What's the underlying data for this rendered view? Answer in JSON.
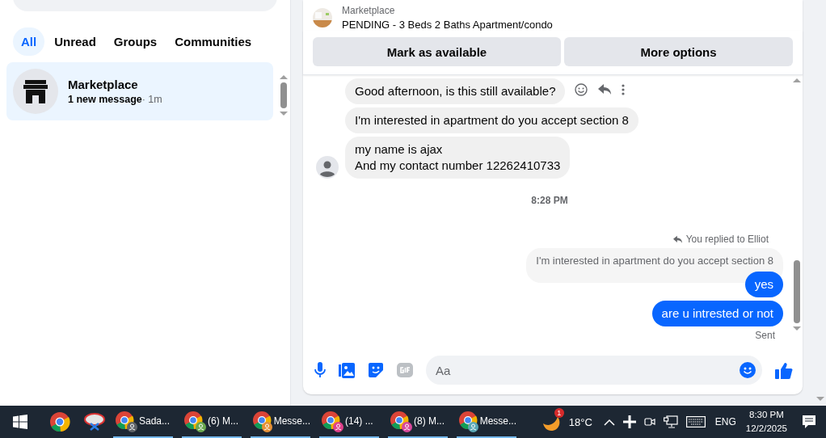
{
  "sidebar": {
    "filters": [
      {
        "label": "All",
        "selected": true
      },
      {
        "label": "Unread",
        "selected": false
      },
      {
        "label": "Groups",
        "selected": false
      },
      {
        "label": "Communities",
        "selected": false
      }
    ],
    "conversations": [
      {
        "name": "Marketplace",
        "preview": "1 new message",
        "time": "· 1m",
        "selected": true
      }
    ]
  },
  "chat": {
    "listing": {
      "label": "Marketplace",
      "title": "PENDING - 3 Beds 2 Baths Apartment/condo"
    },
    "actions": [
      "Mark as available",
      "More options"
    ],
    "messages": [
      {
        "kind": "incoming",
        "lines": [
          "Good afternoon, is this still available?"
        ],
        "show_actions": true,
        "show_avatar": false
      },
      {
        "kind": "incoming",
        "lines": [
          "I'm interested in apartment do you accept section 8"
        ],
        "show_actions": false,
        "show_avatar": false
      },
      {
        "kind": "incoming",
        "lines": [
          "my name is ajax",
          "And my contact number 12262410733"
        ],
        "show_actions": false,
        "show_avatar": true
      },
      {
        "kind": "timestamp",
        "text": "8:28 PM"
      },
      {
        "kind": "reply_note",
        "text": "You replied to Elliot"
      },
      {
        "kind": "quoted",
        "text": "I'm interested in apartment do you accept section 8"
      },
      {
        "kind": "outgoing",
        "text": "yes"
      },
      {
        "kind": "outgoing",
        "text": "are u intrested or not"
      },
      {
        "kind": "status",
        "text": "Sent"
      }
    ],
    "composer": {
      "placeholder": "Aa"
    }
  },
  "taskbar": {
    "apps": [
      {
        "kind": "browser"
      },
      {
        "kind": "snip"
      },
      {
        "kind": "window",
        "label": "Sada...",
        "color": "#5f6368"
      },
      {
        "kind": "window",
        "label": "(6) M...",
        "color": "#6aa84f"
      },
      {
        "kind": "window",
        "label": "Messe...",
        "color": "#e69138"
      },
      {
        "kind": "window",
        "label": "(14) ...",
        "color": "#e0408a"
      },
      {
        "kind": "window",
        "label": "(8) M...",
        "color": "#d9489b"
      },
      {
        "kind": "window",
        "label": "Messe...",
        "color": "#5aa7b5"
      }
    ],
    "weather": {
      "badge": "1",
      "temp": "18°C"
    },
    "language": "ENG",
    "time": "8:30 PM",
    "date": "12/2/2025"
  }
}
